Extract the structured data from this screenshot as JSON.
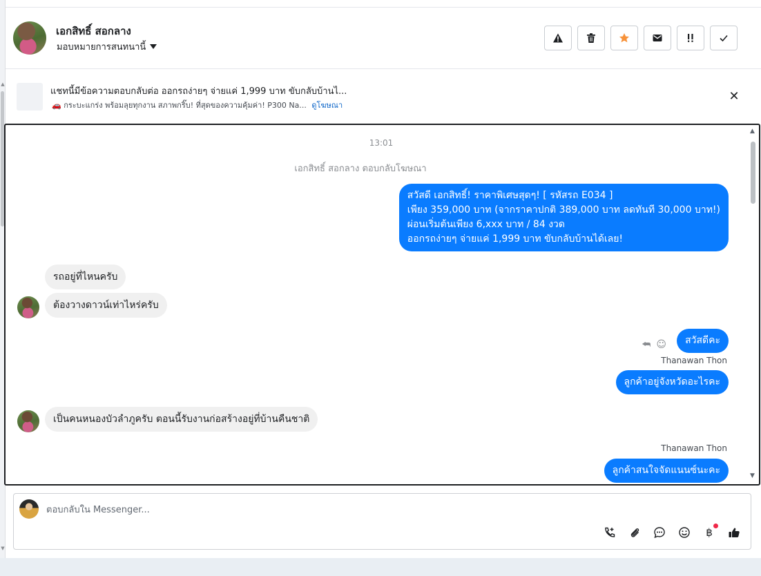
{
  "contact": {
    "name": "เอกสิทธิ์ สอกลาง",
    "assign_label": "มอบหมายการสนทนานี้"
  },
  "header_actions": [
    {
      "icon": "warning-icon"
    },
    {
      "icon": "trash-icon"
    },
    {
      "icon": "star-icon",
      "color": "#f7923a"
    },
    {
      "icon": "mail-icon"
    },
    {
      "icon": "priority-icon"
    },
    {
      "icon": "check-icon"
    }
  ],
  "ad": {
    "title": "แชทนี้มีข้อความตอบกลับต่อ ออกรถง่ายๆ จ่ายแค่ 1,999 บาท ขับกลับบ้านไ...",
    "subtitle": "🚗 กระบะแกร่ง พร้อมลุยทุกงาน สภาพกริ๊บ! ที่สุดของความคุ้มค่า! P300 Na...",
    "link": "ดูโฆษณา"
  },
  "thread": {
    "timestamp": "13:01",
    "system_note": "เอกสิทธิ์ สอกลาง ตอบกลับโฆษณา",
    "ad_reply_lines": [
      "สวัสดี เอกสิทธิ์! ราคาพิเศษสุดๆ! [ รหัสรถ E034 ]",
      "เพียง 359,000 บาท (จากราคาปกติ 389,000 บาท ลดทันที 30,000 บาท!)",
      "ผ่อนเริ่มต้นเพียง 6,xxx บาท / 84 งวด",
      "ออกรถง่ายๆ จ่ายแค่ 1,999 บาท ขับกลับบ้านได้เลย!"
    ],
    "in_1": "รถอยู่ที่ไหนครับ",
    "in_2": "ต้องวางดาวน์เท่าไหร่ครับ",
    "out_1": "สวัสดีคะ",
    "sender_1": "Thanawan Thon",
    "out_2": "ลูกค้าอยู่จังหวัดอะไรคะ",
    "in_3": "เป็นคนหนองบัวลำภูครับ ตอนนี้รับงานก่อสร้างอยู่ที่บ้านคืนชาติ",
    "sender_2": "Thanawan Thon",
    "out_3": "ลูกค้าสนใจจัดแนนซ์นะคะ"
  },
  "composer": {
    "placeholder": "ตอบกลับใน Messenger..."
  },
  "composer_tools": [
    "call-add-icon",
    "attach-icon",
    "saved-reply-icon",
    "emoji-icon",
    "baht-icon",
    "like-icon"
  ],
  "colors": {
    "outgoing_bubble": "#0a7cff",
    "incoming_bubble": "#f0f0f0",
    "link": "#0a64c8",
    "notification_dot": "#f02849"
  }
}
